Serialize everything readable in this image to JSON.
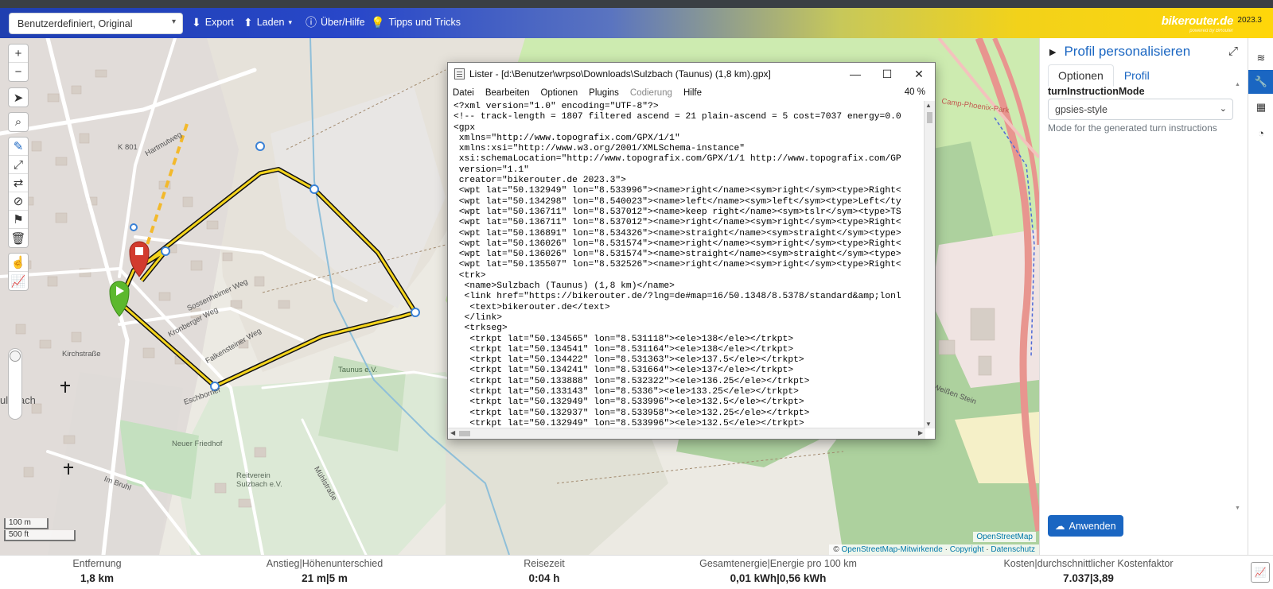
{
  "navbar": {
    "profile_select": "Benutzerdefiniert, Original",
    "export_label": "Export",
    "load_label": "Laden",
    "help_label": "Über/Hilfe",
    "tips_label": "Tipps und Tricks",
    "brand": "bikerouter.de",
    "brand_sub": "powered by BRouter",
    "version": "2023.3"
  },
  "map": {
    "scale_metric": "100 m",
    "scale_imperial": "500 ft",
    "attribution_prefix": "©",
    "attribution_osm": "OpenStreetMap-Mitwirkende",
    "attribution_copyright": "Copyright",
    "attribution_privacy": "Datenschutz",
    "layer_label": "OpenStreetMap",
    "place_labels": [
      "K 801",
      "Hartmutweg",
      "Taunus e.V.",
      "Neuer Friedhof",
      "Reitverein Sulzbach e.V.",
      "ulzbach",
      "Camp-Phoenix-Park",
      "Am Weißen Stein",
      "Eschborner",
      "Kirchstraße",
      "Sossenheimer Weg",
      "Kronberger Weg",
      "Falkensteiner Weg",
      "Im Bruhl",
      "Mühlstraße"
    ]
  },
  "lister": {
    "title": "Lister - [d:\\Benutzer\\wrpso\\Downloads\\Sulzbach (Taunus) (1,8 km).gpx]",
    "menu": [
      "Datei",
      "Bearbeiten",
      "Optionen",
      "Plugins",
      "Codierung",
      "Hilfe"
    ],
    "zoom": "40 %",
    "lines": [
      "<?xml version=\"1.0\" encoding=\"UTF-8\"?>",
      "<!-- track-length = 1807 filtered ascend = 21 plain-ascend = 5 cost=7037 energy=0.0",
      "<gpx",
      " xmlns=\"http://www.topografix.com/GPX/1/1\"",
      " xmlns:xsi=\"http://www.w3.org/2001/XMLSchema-instance\"",
      " xsi:schemaLocation=\"http://www.topografix.com/GPX/1/1 http://www.topografix.com/GP",
      " version=\"1.1\"",
      " creator=\"bikerouter.de 2023.3\">",
      " <wpt lat=\"50.132949\" lon=\"8.533996\"><name>right</name><sym>right</sym><type>Right<",
      " <wpt lat=\"50.134298\" lon=\"8.540023\"><name>left</name><sym>left</sym><type>Left</ty",
      " <wpt lat=\"50.136711\" lon=\"8.537012\"><name>keep right</name><sym>tslr</sym><type>TS",
      " <wpt lat=\"50.136711\" lon=\"8.537012\"><name>right</name><sym>right</sym><type>Right<",
      " <wpt lat=\"50.136891\" lon=\"8.534326\"><name>straight</name><sym>straight</sym><type>",
      " <wpt lat=\"50.136026\" lon=\"8.531574\"><name>right</name><sym>right</sym><type>Right<",
      " <wpt lat=\"50.136026\" lon=\"8.531574\"><name>straight</name><sym>straight</sym><type>",
      " <wpt lat=\"50.135507\" lon=\"8.532526\"><name>right</name><sym>right</sym><type>Right<",
      " <trk>",
      "  <name>Sulzbach (Taunus) (1,8 km)</name>",
      "  <link href=\"https://bikerouter.de/?lng=de#map=16/50.1348/8.5378/standard&amp;lonl",
      "   <text>bikerouter.de</text>",
      "  </link>",
      "  <trkseg>",
      "   <trkpt lat=\"50.134565\" lon=\"8.531118\"><ele>138</ele></trkpt>",
      "   <trkpt lat=\"50.134541\" lon=\"8.531164\"><ele>138</ele></trkpt>",
      "   <trkpt lat=\"50.134422\" lon=\"8.531363\"><ele>137.5</ele></trkpt>",
      "   <trkpt lat=\"50.134241\" lon=\"8.531664\"><ele>137</ele></trkpt>",
      "   <trkpt lat=\"50.133888\" lon=\"8.532322\"><ele>136.25</ele></trkpt>",
      "   <trkpt lat=\"50.133143\" lon=\"8.5336\"><ele>133.25</ele></trkpt>",
      "   <trkpt lat=\"50.132949\" lon=\"8.533996\"><ele>132.5</ele></trkpt>",
      "   <trkpt lat=\"50.132937\" lon=\"8.533958\"><ele>132.25</ele></trkpt>",
      "   <trkpt lat=\"50.132949\" lon=\"8.533996\"><ele>132.5</ele></trkpt>"
    ]
  },
  "panel": {
    "title": "Profil personalisieren",
    "tabs": [
      "Optionen",
      "Profil"
    ],
    "option_label": "turnInstructionMode",
    "option_value": "gpsies-style",
    "option_help": "Mode for the generated turn instructions",
    "apply_label": "Anwenden"
  },
  "stats": [
    {
      "label": "Entfernung",
      "value": "1,8 km"
    },
    {
      "label": "Anstieg|Höhenunterschied",
      "value": "21 m|5 m"
    },
    {
      "label": "Reisezeit",
      "value": "0:04 h"
    },
    {
      "label": "Gesamtenergie|Energie pro 100 km",
      "value": "0,01 kWh|0,56 kWh"
    },
    {
      "label": "Kosten|durchschnittlicher Kostenfaktor",
      "value": "7.037|3,89"
    }
  ],
  "colors": {
    "accent": "#1a66c2",
    "route": "#f4d41c",
    "route_outline": "#111111",
    "start_marker": "#5cb82e",
    "end_marker": "#d23b2e"
  }
}
